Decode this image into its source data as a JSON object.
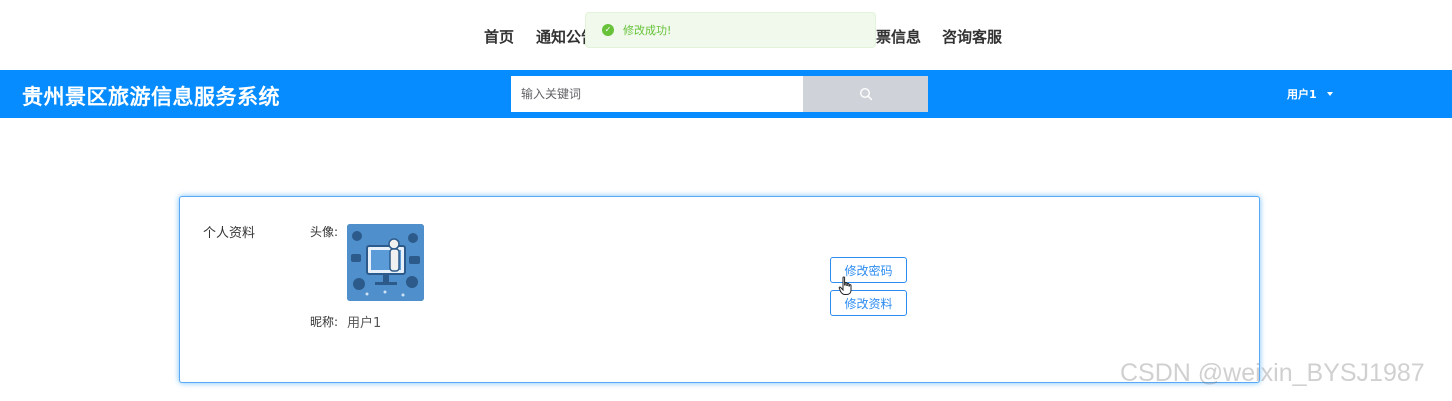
{
  "nav": {
    "items": [
      "首页",
      "通知公告",
      "票信息",
      "咨询客服"
    ]
  },
  "toast": {
    "message": "修改成功!",
    "icon": "check-circle-icon",
    "color": "#67c23a"
  },
  "header": {
    "title": "贵州景区旅游信息服务系统",
    "search_placeholder": "输入关键词",
    "search_icon": "search-icon",
    "user_name": "用户1",
    "bg_color": "#068cfe"
  },
  "profile": {
    "section_label": "个人资料",
    "avatar_label": "头像:",
    "nickname_label": "昵称:",
    "nickname_value": "用户1",
    "change_password_label": "修改密码",
    "edit_profile_label": "修改资料"
  },
  "watermark": "CSDN @weixin_BYSJ1987"
}
